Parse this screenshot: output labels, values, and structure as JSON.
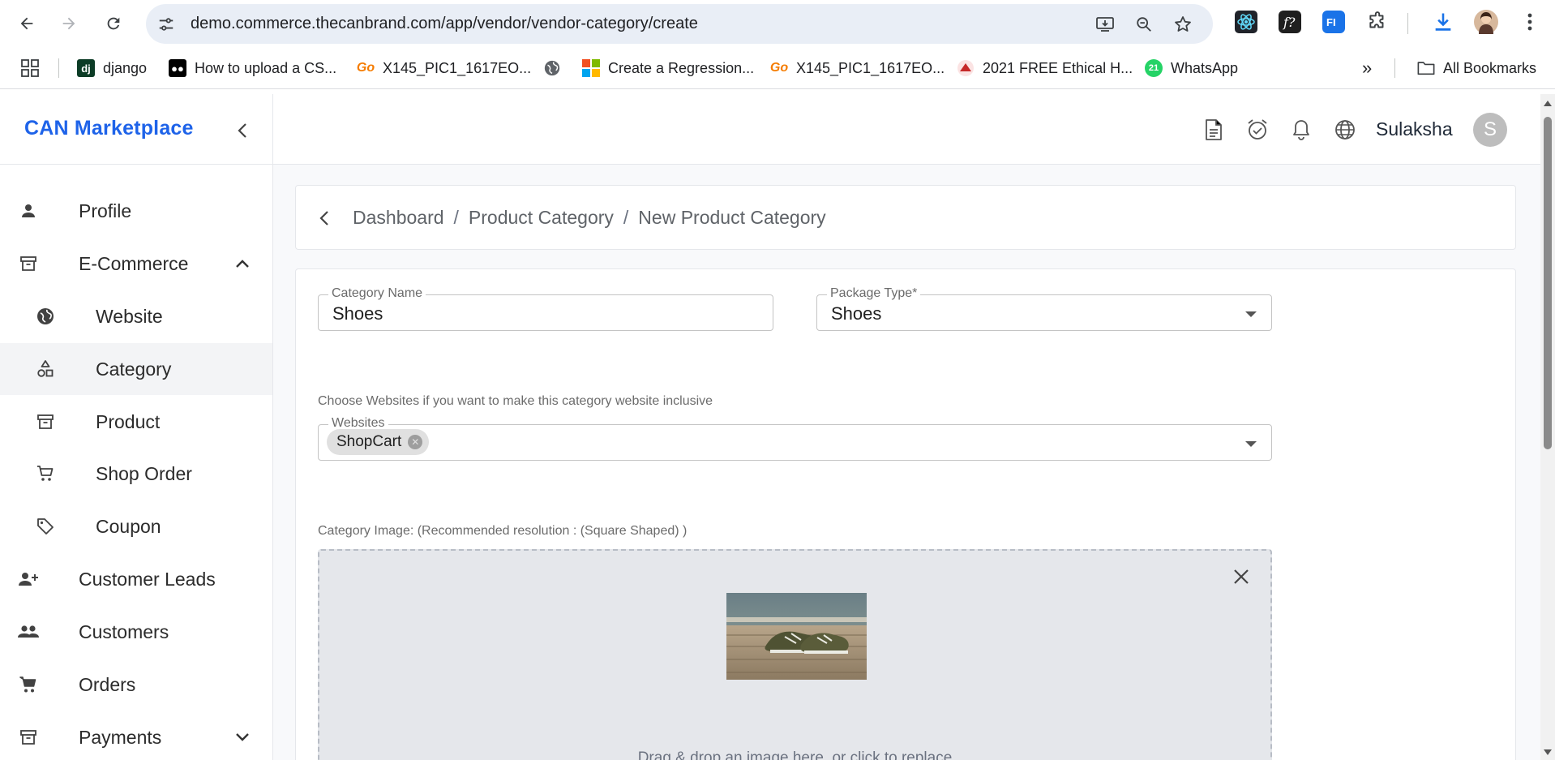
{
  "browser": {
    "url": "demo.commerce.thecanbrand.com/app/vendor/vendor-category/create",
    "bookmarks": [
      {
        "label": "django",
        "icon": "django-favicon"
      },
      {
        "label": "How to upload a CS...",
        "icon": "medium-favicon"
      },
      {
        "label": "X145_PIC1_1617EO...",
        "icon": "go-favicon"
      },
      {
        "label": "",
        "icon": "globe-favicon"
      },
      {
        "label": "Create a Regression...",
        "icon": "microsoft-favicon"
      },
      {
        "label": "X145_PIC1_1617EO...",
        "icon": "go-favicon"
      },
      {
        "label": "2021 FREE Ethical H...",
        "icon": "ethical-hacking-favicon"
      },
      {
        "label": "WhatsApp",
        "icon": "whatsapp-favicon",
        "badge": "21"
      }
    ],
    "more_label": "»",
    "all_bookmarks": "All Bookmarks"
  },
  "app": {
    "brand": "CAN Marketplace",
    "user": {
      "name": "Sulaksha",
      "initial": "S"
    }
  },
  "sidebar": {
    "items": [
      {
        "label": "Profile",
        "icon": "person-icon"
      },
      {
        "label": "E-Commerce",
        "icon": "archive-icon",
        "expanded": true
      },
      {
        "label": "Website",
        "icon": "globe-icon",
        "sub": true
      },
      {
        "label": "Category",
        "icon": "shapes-icon",
        "sub": true,
        "active": true
      },
      {
        "label": "Product",
        "icon": "archive-icon",
        "sub": true
      },
      {
        "label": "Shop Order",
        "icon": "cart-icon",
        "sub": true
      },
      {
        "label": "Coupon",
        "icon": "tag-icon",
        "sub": true
      },
      {
        "label": "Customer Leads",
        "icon": "add-person-icon"
      },
      {
        "label": "Customers",
        "icon": "people-icon"
      },
      {
        "label": "Orders",
        "icon": "cart-icon"
      },
      {
        "label": "Payments",
        "icon": "archive-icon",
        "expanded": false
      }
    ]
  },
  "breadcrumb": {
    "items": [
      "Dashboard",
      "Product Category",
      "New Product Category"
    ],
    "separator": "/"
  },
  "form": {
    "category_name": {
      "label": "Category Name",
      "value": "Shoes"
    },
    "package_type": {
      "label": "Package Type",
      "required_mark": "*",
      "value": "Shoes"
    },
    "websites_hint": "Choose Websites if you want to make this category website inclusive",
    "websites": {
      "label": "Websites",
      "chips": [
        "ShopCart"
      ]
    },
    "image_label": "Category Image: (Recommended resolution : (Square Shaped) )",
    "dropzone_text": "Drag & drop an image here, or click to replace"
  },
  "colors": {
    "brand": "#1e63e9",
    "active_bg": "#f3f4f6",
    "dropzone_bg": "#e5e7eb"
  }
}
